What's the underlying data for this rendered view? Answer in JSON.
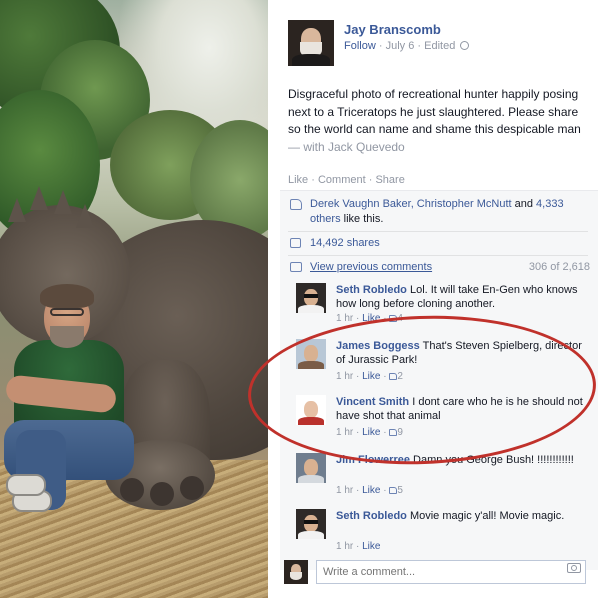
{
  "post": {
    "author": "Jay Branscomb",
    "follow_label": "Follow",
    "date": "July 6",
    "edited_label": "Edited",
    "text": "Disgraceful photo of recreational hunter happily posing next to a Triceratops he just slaughtered. Please share so the world can name and shame this despicable man",
    "with_text": "— with Jack Quevedo",
    "actions": {
      "like": "Like",
      "comment": "Comment",
      "share": "Share",
      "sep": "·"
    }
  },
  "summary": {
    "likes_text": "Derek Vaughn Baker, Christopher McNutt",
    "likes_and": "and",
    "likes_others": "4,333 others",
    "likes_suffix": "like this.",
    "shares": "14,492 shares",
    "view_previous": "View previous comments",
    "comment_count": "306 of 2,618"
  },
  "comments": [
    {
      "name": "Seth Robledo",
      "text": "Lol. It will take En-Gen who knows how long before cloning another.",
      "time": "1 hr",
      "like_label": "Like",
      "likes": "4"
    },
    {
      "name": "James Boggess",
      "text": "That's Steven Spielberg, director of Jurassic Park!",
      "time": "1 hr",
      "like_label": "Like",
      "likes": "2"
    },
    {
      "name": "Vincent Smith",
      "text": "I dont care who he is he should not have shot that animal",
      "time": "1 hr",
      "like_label": "Like",
      "likes": "9"
    },
    {
      "name": "Jim Flowerree",
      "text": "Damn you George Bush! !!!!!!!!!!!!",
      "time": "1 hr",
      "like_label": "Like",
      "likes": "5"
    },
    {
      "name": "Seth Robledo",
      "text": "Movie magic y'all! Movie magic.",
      "time": "1 hr",
      "like_label": "Like"
    }
  ],
  "composer": {
    "placeholder": "Write a comment..."
  },
  "colors": {
    "link": "#3b5998",
    "muted": "#9197a3",
    "highlight_ring": "#c0312b"
  },
  "icons": {
    "thumb": "thumbs-up-icon",
    "share": "share-icon",
    "comment": "comment-icon",
    "camera": "camera-icon",
    "globe": "globe-icon"
  }
}
